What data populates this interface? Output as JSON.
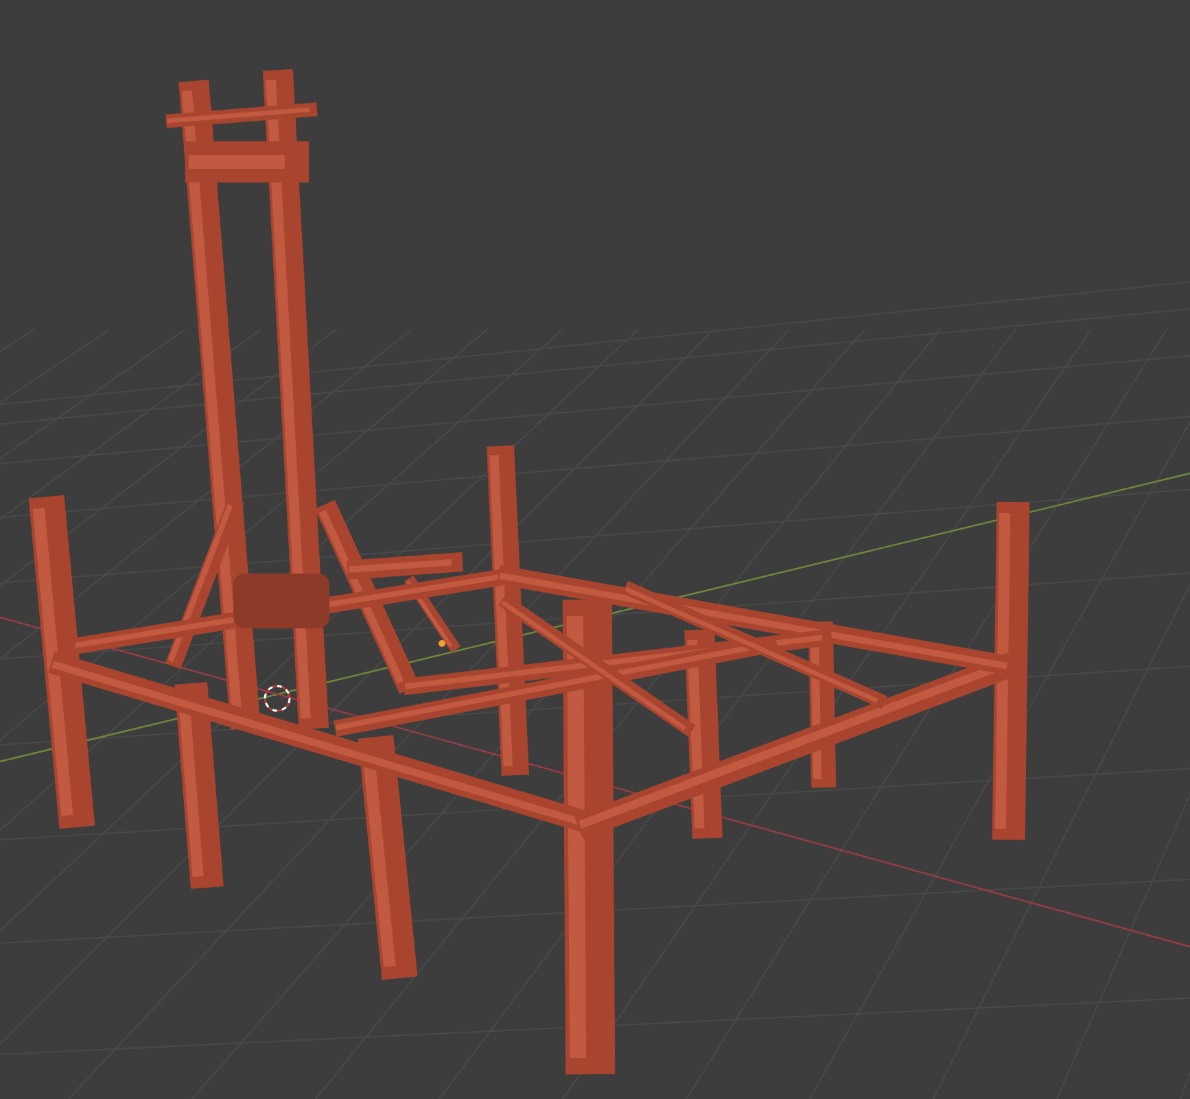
{
  "viewport": {
    "show_grid": true,
    "show_axes": true
  }
}
